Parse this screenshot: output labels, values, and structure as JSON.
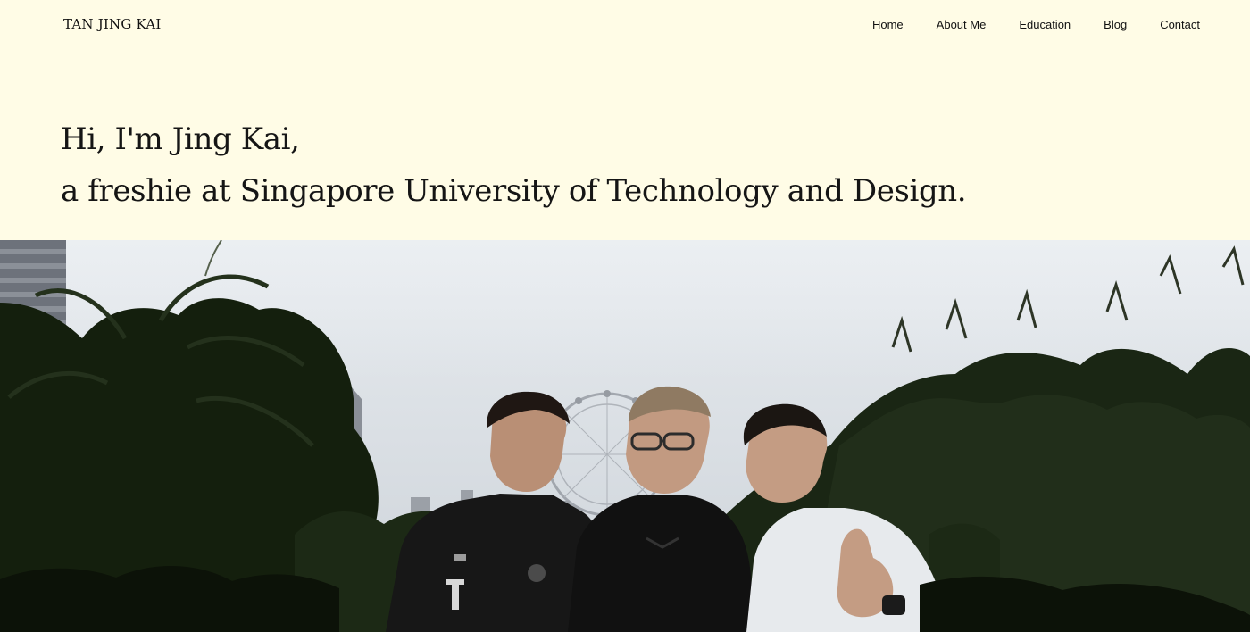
{
  "site": {
    "brand": "TAN JING KAI"
  },
  "nav": {
    "items": [
      {
        "label": "Home"
      },
      {
        "label": "About Me"
      },
      {
        "label": "Education"
      },
      {
        "label": "Blog"
      },
      {
        "label": "Contact"
      }
    ]
  },
  "hero": {
    "line1": "Hi, I'm Jing Kai,",
    "line2": "a freshie at Singapore University of Technology and Design."
  },
  "photo": {
    "subject": "group-photo-outdoors",
    "colors": {
      "sky": "#d9dde3",
      "foliage": "#17220f",
      "building": "#8a8f97",
      "shirt_dark": "#171717",
      "shirt_white": "#e9ecef"
    }
  }
}
